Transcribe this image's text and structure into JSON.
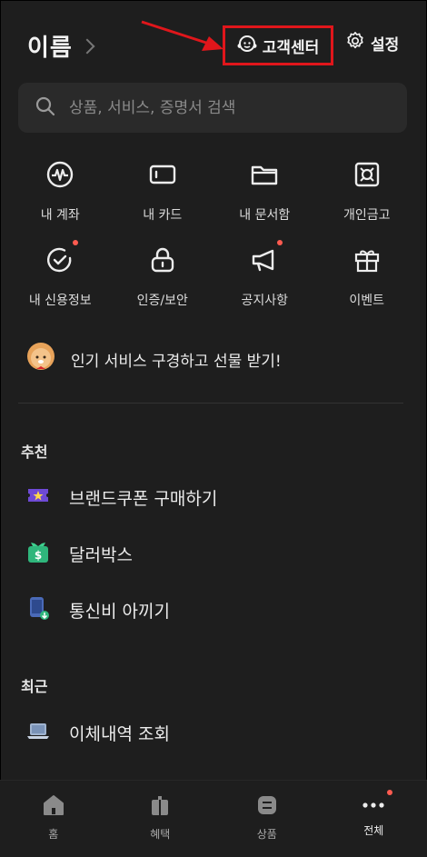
{
  "header": {
    "user_name": "이름",
    "customer_center_label": "고객센터",
    "settings_label": "설정"
  },
  "search": {
    "placeholder": "상품, 서비스, 증명서 검색"
  },
  "quick_menu": [
    {
      "label": "내 계좌",
      "icon": "wave-circle-icon",
      "dot": false
    },
    {
      "label": "내 카드",
      "icon": "card-icon",
      "dot": false
    },
    {
      "label": "내 문서함",
      "icon": "folder-icon",
      "dot": false
    },
    {
      "label": "개인금고",
      "icon": "safe-icon",
      "dot": false
    },
    {
      "label": "내 신용정보",
      "icon": "credit-check-icon",
      "dot": true
    },
    {
      "label": "인증/보안",
      "icon": "lock-icon",
      "dot": false
    },
    {
      "label": "공지사항",
      "icon": "megaphone-icon",
      "dot": true
    },
    {
      "label": "이벤트",
      "icon": "gift-icon",
      "dot": false
    }
  ],
  "promo": {
    "text": "인기 서비스 구경하고 선물 받기!",
    "icon": "lion-character-icon"
  },
  "recommend": {
    "title": "추천",
    "items": [
      {
        "label": "브랜드쿠폰 구매하기",
        "icon": "coupon-icon"
      },
      {
        "label": "달러박스",
        "icon": "dollar-box-icon"
      },
      {
        "label": "통신비 아끼기",
        "icon": "phone-bill-icon"
      }
    ]
  },
  "recent": {
    "title": "최근",
    "items": [
      {
        "label": "이체내역 조회",
        "icon": "laptop-icon"
      }
    ]
  },
  "bottom_nav": [
    {
      "label": "홈",
      "icon": "home-icon",
      "active": false
    },
    {
      "label": "혜택",
      "icon": "benefit-icon",
      "active": false
    },
    {
      "label": "상품",
      "icon": "products-icon",
      "active": false
    },
    {
      "label": "전체",
      "icon": "more-icon",
      "active": true,
      "dot": true
    }
  ],
  "colors": {
    "background": "#1e1e1e",
    "highlight_box": "#e0161b",
    "notification_dot": "#ff5b50",
    "surface": "#2a2a2a"
  }
}
